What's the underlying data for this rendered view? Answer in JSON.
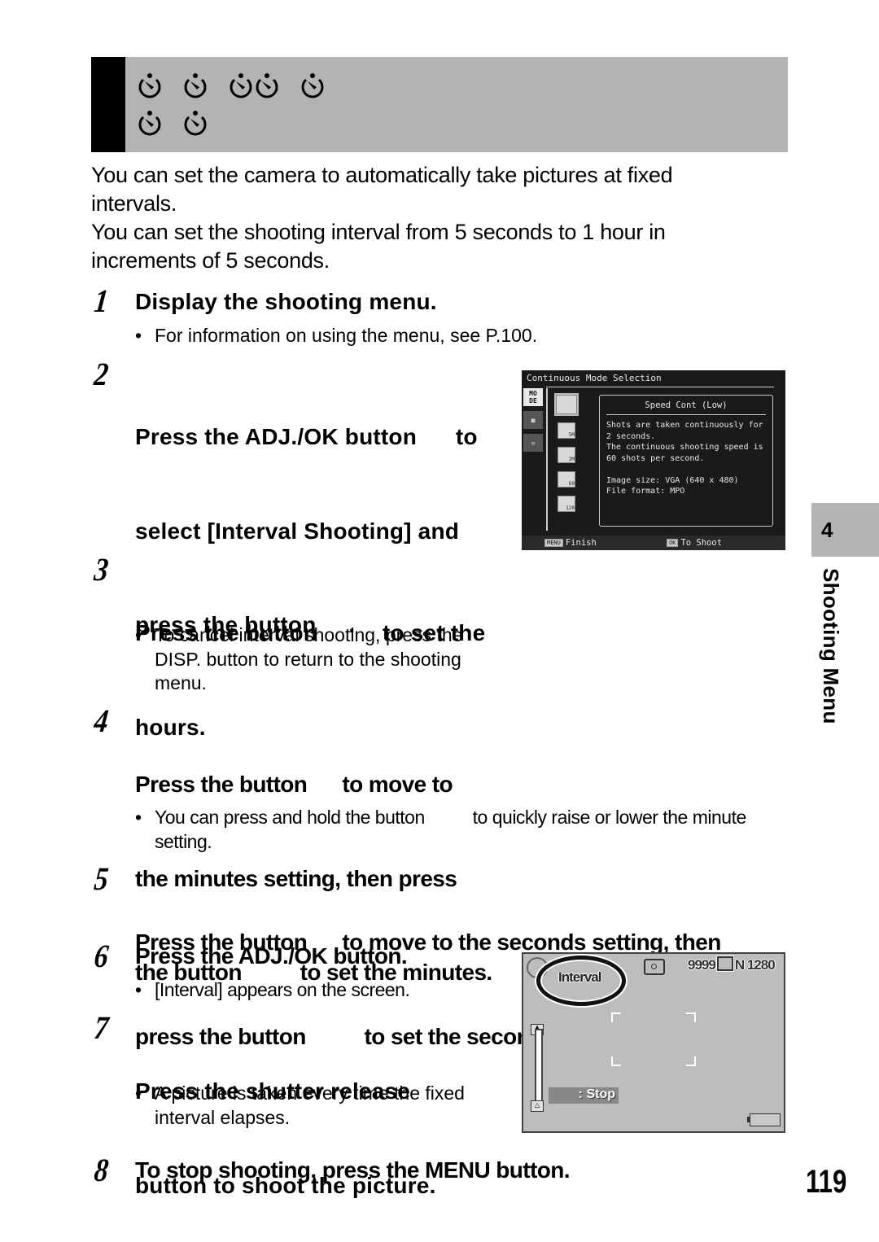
{
  "title_band": {
    "icons_row1": [
      "self-timer-icon",
      "self-timer-icon",
      "self-timer-icon",
      "self-timer-icon",
      "self-timer-icon"
    ],
    "icons_row2": [
      "self-timer-icon",
      "self-timer-icon"
    ]
  },
  "intro": {
    "paragraph1": "You can set the camera to automatically take pictures at fixed intervals.",
    "paragraph2": "You can set the shooting interval from 5 seconds to 1 hour in increments of 5 seconds."
  },
  "steps": [
    {
      "number": "1",
      "heading": "Display the shooting menu.",
      "bullets": [
        "For information on using the menu, see P.100."
      ]
    },
    {
      "number": "2",
      "heading_lines": [
        "Press the ADJ./OK button      to",
        "select [Interval Shooting] and",
        "press the button     ."
      ],
      "bullets": []
    },
    {
      "number": "3",
      "heading_lines": [
        "Press the button          to set the",
        "hours."
      ],
      "bullets": [
        "To cancel interval shooting, press the DISP. button to return to the shooting menu."
      ]
    },
    {
      "number": "4",
      "heading_lines": [
        "Press the button      to move to",
        "the minutes setting, then press",
        "the button          to set the minutes."
      ],
      "bullets": [
        "You can press and hold the button          to quickly raise or lower the minute setting."
      ]
    },
    {
      "number": "5",
      "heading_lines": [
        "Press the button      to move to the seconds setting, then",
        "press the button          to set the seconds."
      ],
      "bullets": []
    },
    {
      "number": "6",
      "heading": "Press the ADJ./OK button.",
      "bullets": [
        "[Interval] appears on the screen."
      ]
    },
    {
      "number": "7",
      "heading_lines": [
        "Press the shutter release",
        "button to shoot the picture."
      ],
      "bullets": [
        "A picture is taken every time the fixed interval elapses."
      ]
    },
    {
      "number": "8",
      "heading": "To stop shooting, press the MENU button.",
      "bullets": []
    }
  ],
  "camera_menu_screen": {
    "header": "Continuous Mode Selection",
    "side_tabs": [
      "MODE",
      "camera-icon",
      "settings-icon"
    ],
    "options": [
      "speed-cont-low",
      "M-cont-5M",
      "M-cont-2M",
      "speed-cont-60",
      "speed-cont-120"
    ],
    "option_badges": [
      "",
      "5M",
      "2M",
      "60",
      "120"
    ],
    "selected_option_title": "Speed Cont (Low)",
    "description": "Shots are taken continuously for\n2 seconds.\nThe continuous shooting speed is\n60 shots per second.\n\nImage size: VGA (640 x 480)\nFile format: MPO",
    "footer_left_key": "MENU",
    "footer_left_label": "Finish",
    "footer_right_key": "OK",
    "footer_right_label": "To Shoot"
  },
  "camera_shooting_screen": {
    "interval_label": "Interval",
    "remaining_shots": "9999",
    "image_size": "N 1280",
    "stop_label": ": Stop"
  },
  "chapter": {
    "number": "4",
    "label": "Shooting Menu"
  },
  "page_number": "119"
}
